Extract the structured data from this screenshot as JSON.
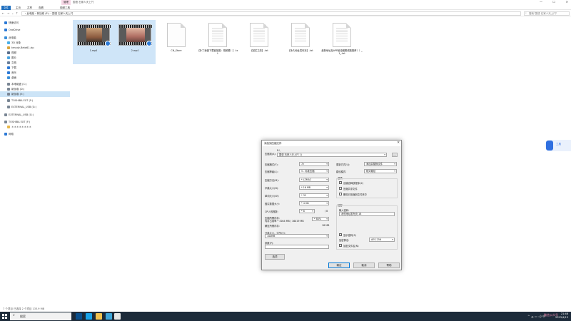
{
  "window": {
    "title_context_tab": "管理",
    "title_text": "国语 石家人天上闩"
  },
  "ribbon": {
    "tabs": [
      "文件",
      "主页",
      "共享",
      "查看",
      "视频工具"
    ]
  },
  "address": {
    "path": "› 此电脑 › 新加卷 (E:) › 国语 石家人天上闩",
    "search_placeholder": "搜索\"国语 石家人天上闩\""
  },
  "sidebar": {
    "items": [
      {
        "label": "快速访问",
        "icon": "star-icon",
        "color": "#2b79d6",
        "indent": 1
      },
      {
        "label": "OneDrive",
        "icon": "cloud-icon",
        "color": "#2b79d6",
        "indent": 1
      },
      {
        "label": "此电脑",
        "icon": "computer-icon",
        "color": "#3a8fd9",
        "indent": 1
      },
      {
        "label": "3D 对象",
        "icon": "cube-icon",
        "color": "#4ab0e8",
        "indent": 2
      },
      {
        "label": "kmody-Beta61.zip",
        "icon": "zip-icon",
        "color": "#d9a33a",
        "indent": 2
      },
      {
        "label": "视频",
        "icon": "video-icon",
        "color": "#5a6e8a",
        "indent": 2
      },
      {
        "label": "图片",
        "icon": "picture-icon",
        "color": "#4aa3df",
        "indent": 2
      },
      {
        "label": "文档",
        "icon": "document-icon",
        "color": "#6a7f9a",
        "indent": 2
      },
      {
        "label": "下载",
        "icon": "download-icon",
        "color": "#2b79d6",
        "indent": 2
      },
      {
        "label": "音乐",
        "icon": "music-icon",
        "color": "#2b79d6",
        "indent": 2
      },
      {
        "label": "桌面",
        "icon": "desktop-icon",
        "color": "#3a8fd9",
        "indent": 2
      },
      {
        "label": "本地磁盘 (C:)",
        "icon": "drive-icon",
        "color": "#7a8694",
        "indent": 2
      },
      {
        "label": "新加卷 (D:)",
        "icon": "drive-icon",
        "color": "#7a8694",
        "indent": 2
      },
      {
        "label": "新加卷 (E:)",
        "icon": "drive-icon",
        "color": "#7a8694",
        "indent": 2,
        "selected": true
      },
      {
        "label": "TOSHIBA EXT (F:)",
        "icon": "drive-icon",
        "color": "#7a8694",
        "indent": 2
      },
      {
        "label": "EXTERNAL_USB (G:)",
        "icon": "drive-icon",
        "color": "#7a8694",
        "indent": 2
      },
      {
        "label": "EXTERNAL_USB (G:)",
        "icon": "usb-icon",
        "color": "#7a8694",
        "indent": 1
      },
      {
        "label": "TOSHIBA EXT (F:)",
        "icon": "usb-icon",
        "color": "#7a8694",
        "indent": 1
      },
      {
        "label": "＊＊＊＊＊＊＊＊",
        "icon": "folder-icon",
        "color": "#e8b84a",
        "indent": 2
      },
      {
        "label": "网络",
        "icon": "network-icon",
        "color": "#2b79d6",
        "indent": 1
      }
    ]
  },
  "files": [
    {
      "name": "1.mp4",
      "kind": "video-a",
      "selected": true
    },
    {
      "name": "2.mp4",
      "kind": "video-b",
      "selected": true
    },
    {
      "name": "CN_Store",
      "kind": "blank"
    },
    {
      "name": "【补丁我做下载链接图：视频看！】.txt",
      "kind": "lines"
    },
    {
      "name": "【回忆之前】.txt",
      "kind": "lines"
    },
    {
      "name": "【永久地址发布页】.txt",
      "kind": "lines"
    },
    {
      "name": "最新地址及APP最佳観看线路推荐！！_1_.txt",
      "kind": "lines"
    }
  ],
  "status": {
    "text": "7 个项目    已选择 2 个项目 133.9 MB"
  },
  "dialog": {
    "title": "添加到压缩文件",
    "close": "✕",
    "archive_label": "压缩到(A):",
    "archive_sub": "E:\\",
    "archive_value": "国语 石家人天上闩 1)",
    "browse": "...",
    "format_label": "压缩格式(F):",
    "format_value": "7z",
    "level_label": "压缩等级(L):",
    "level_value": "5 - 标准压缩",
    "method_label": "压缩方法(M):",
    "method_value": "* LZMA2",
    "dict_label": "字典大小(D):",
    "dict_value": "* 16 MB",
    "word_label": "单词大小(W):",
    "word_value": "* 32",
    "solid_label": "固实数据大小:",
    "solid_value": "* 4 GB",
    "cpu_label": "CPU 线程数:",
    "cpu_value": "* 8",
    "cpu_max": "/ 8",
    "mem_label": "压缩所需内存:",
    "mem_info": "内存占用率 * 3264 MB / 16019 MB",
    "mem_percent": "* 80%",
    "decomp_label": "解压所需内存:",
    "decomp_value": "18 MB",
    "split_label": "分卷大小，字节(V):",
    "split_value": "100MB",
    "params_label": "参数(P):",
    "params_value": "",
    "options_button": "选项",
    "update_label": "更新方式(U):",
    "update_value": "添加并替换文件",
    "path_label": "路径模式:",
    "path_value": "相对路径",
    "opts_title": "选项",
    "opt1": "创建自释放程序(X)",
    "opt2": "压缩共享文件",
    "opt3": "删除已压缩到文件夹中",
    "encrypt_title": "加密",
    "password_label": "输入密码:",
    "password_value": "永恒地址发布页 18",
    "show_pwd": "显示密码(S)",
    "enc_method_label": "加密算法:",
    "enc_method_value": "AES-256",
    "enc_names": "加密文件名(N)",
    "ok": "确定",
    "cancel": "取消",
    "help": "帮助"
  },
  "floating": {
    "label": "工具"
  },
  "taskbar": {
    "search": "搜索",
    "time": "21:46",
    "date": "2023/4/13",
    "tray": "^  ☁  ▭  ◁)  中"
  },
  "watermark": "微信公众号"
}
